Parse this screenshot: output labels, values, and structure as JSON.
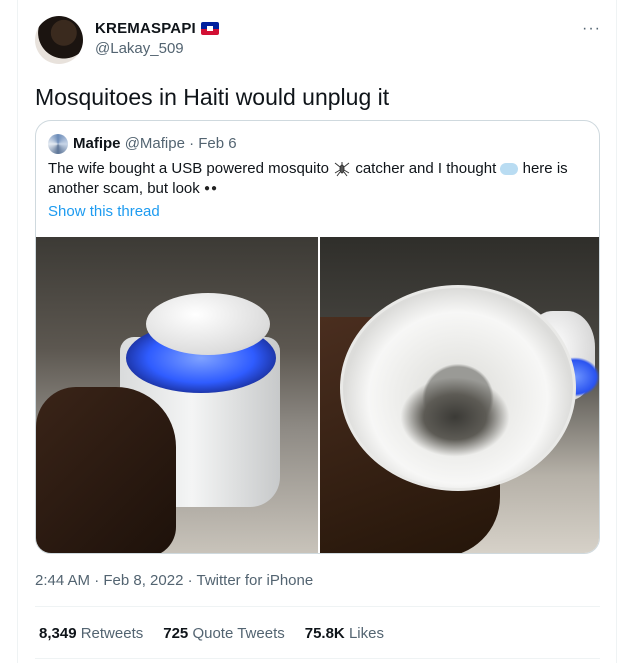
{
  "tweet": {
    "display_name": "KREMASPAPI",
    "handle": "@Lakay_509",
    "more_icon": "more-icon",
    "text": "Mosquitoes in Haiti would unplug it",
    "timestamp": "2:44 AM · Feb 8, 2022 · Twitter for iPhone"
  },
  "quote": {
    "display_name": "Mafipe",
    "handle": "@Mafipe",
    "date": "· Feb 6",
    "text_part1": "The wife bought a USB powered mosquito",
    "text_part2": "catcher and I thought",
    "text_part3": "here is another scam, but look",
    "show_thread": "Show this thread"
  },
  "stats": {
    "retweets_count": "8,349",
    "retweets_label": "Retweets",
    "quotes_count": "725",
    "quotes_label": "Quote Tweets",
    "likes_count": "75.8K",
    "likes_label": "Likes"
  },
  "colors": {
    "link": "#1d9bf0",
    "muted": "#536471",
    "text": "#0f1419",
    "border": "#cfd9de"
  }
}
